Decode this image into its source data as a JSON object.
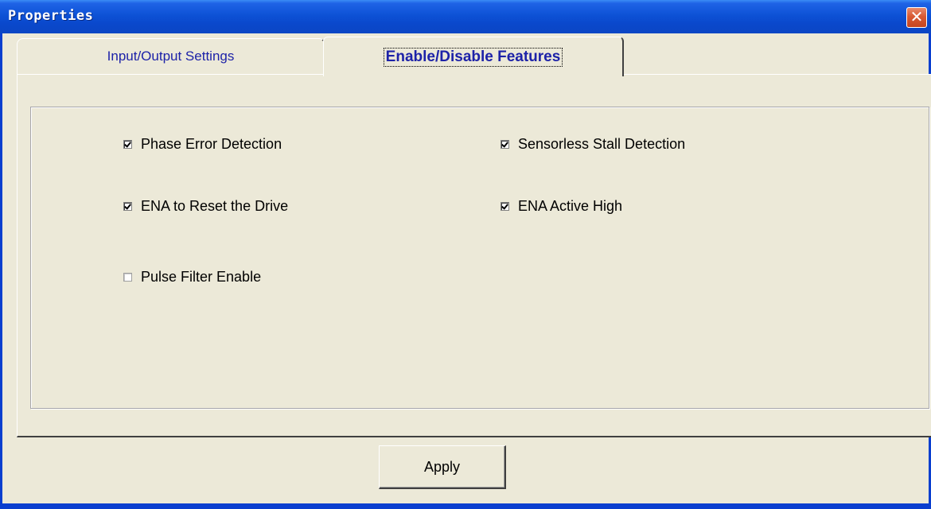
{
  "window": {
    "title": "Properties",
    "close_icon": "close-icon"
  },
  "tabs": [
    {
      "label": "Input/Output Settings",
      "selected": false
    },
    {
      "label": "Enable/Disable Features",
      "selected": true
    }
  ],
  "options": [
    {
      "label": "Phase Error Detection",
      "checked": true
    },
    {
      "label": "Sensorless Stall Detection",
      "checked": true
    },
    {
      "label": "ENA to Reset the Drive",
      "checked": true
    },
    {
      "label": "ENA Active High",
      "checked": true
    },
    {
      "label": "Pulse Filter Enable",
      "checked": false
    }
  ],
  "apply_button": {
    "label": "Apply"
  },
  "colors": {
    "title_bar": "#0a48cc",
    "face": "#ece9d8",
    "tab_text": "#1d22a8",
    "close": "#d85a33"
  }
}
